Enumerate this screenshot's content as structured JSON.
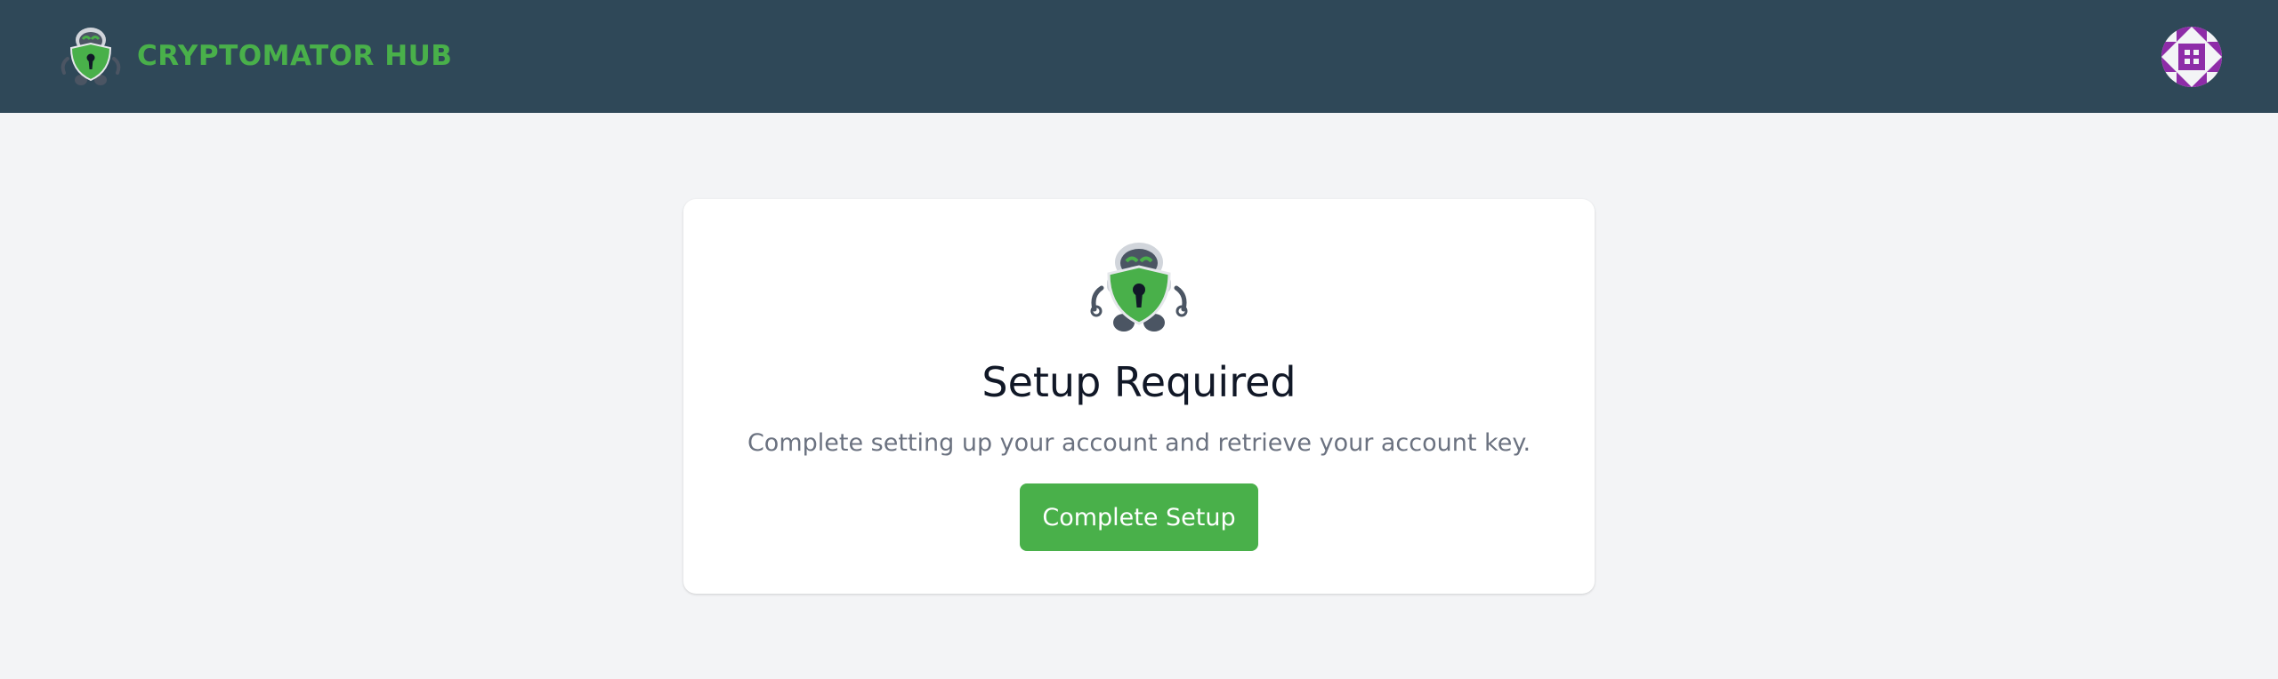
{
  "header": {
    "brand_name": "CRYPTOMATOR HUB",
    "logo_icon": "cryptomator-robot-icon",
    "avatar_icon": "identicon-avatar-icon"
  },
  "card": {
    "icon": "cryptomator-robot-icon",
    "title": "Setup Required",
    "description": "Complete setting up your account and retrieve your account key.",
    "button_label": "Complete Setup"
  },
  "colors": {
    "header_bg": "#2f4858",
    "brand_green": "#49b04a",
    "page_bg": "#f3f4f6",
    "card_bg": "#ffffff",
    "title_text": "#111827",
    "muted_text": "#6b7280",
    "avatar_purple": "#8e2ca8"
  }
}
